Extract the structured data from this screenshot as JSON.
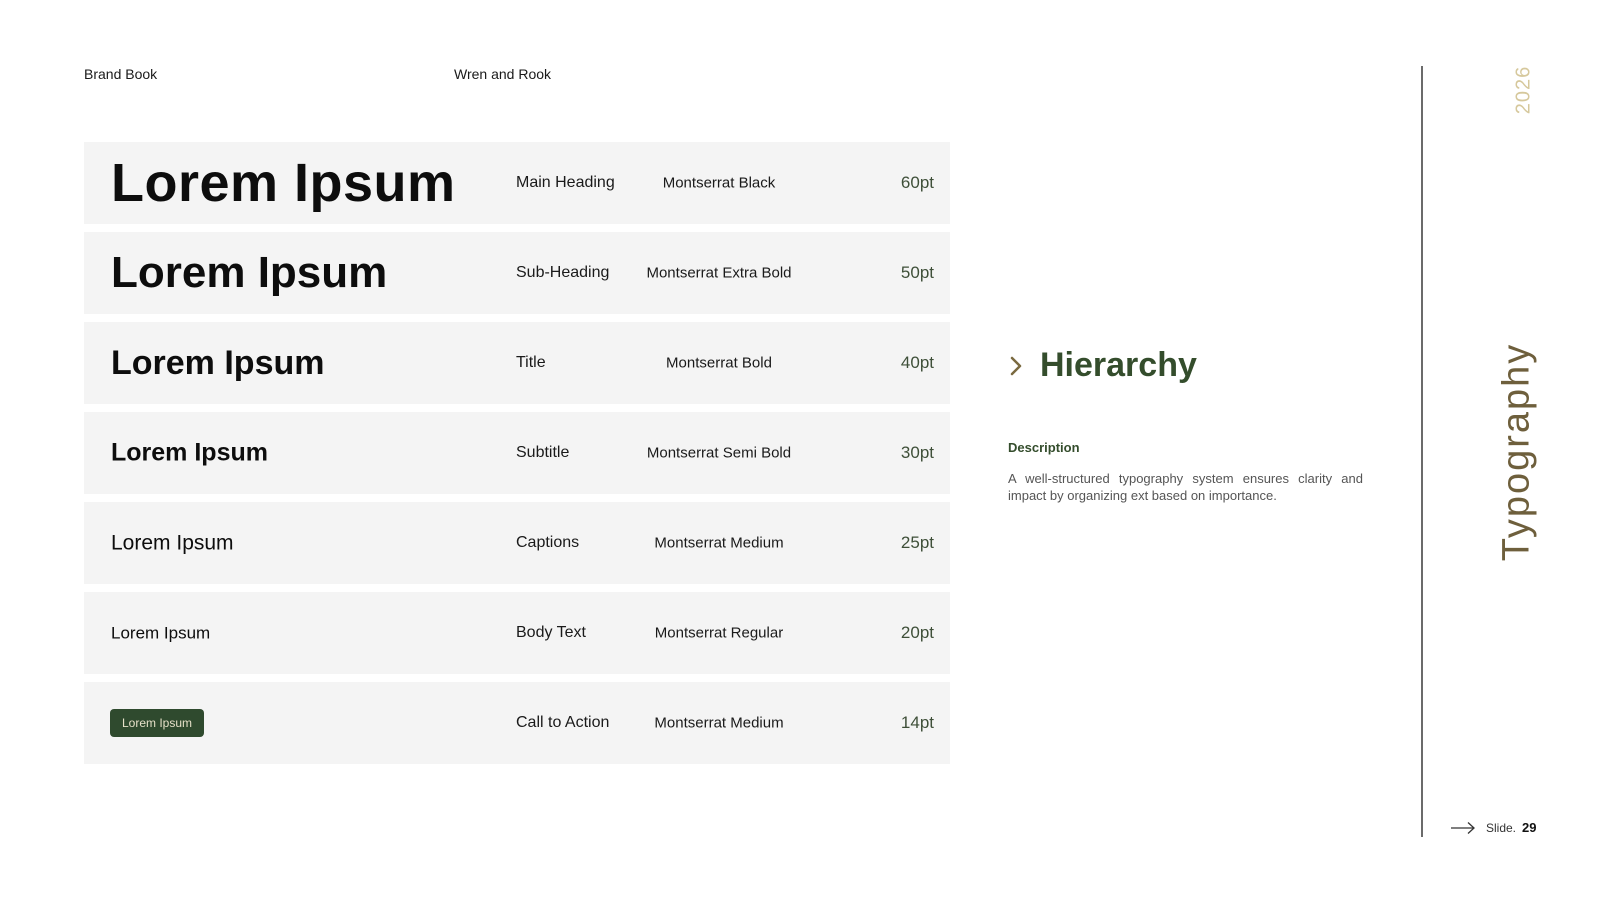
{
  "header": {
    "brand": "Brand Book",
    "company": "Wren and Rook"
  },
  "hierarchy_rows": [
    {
      "sample": "Lorem Ipsum",
      "role": "Main Heading",
      "font": "Montserrat Black",
      "size": "60pt"
    },
    {
      "sample": "Lorem Ipsum",
      "role": "Sub-Heading",
      "font": "Montserrat Extra Bold",
      "size": "50pt"
    },
    {
      "sample": "Lorem Ipsum",
      "role": "Title",
      "font": "Montserrat Bold",
      "size": "40pt"
    },
    {
      "sample": "Lorem Ipsum",
      "role": "Subtitle",
      "font": "Montserrat Semi Bold",
      "size": "30pt"
    },
    {
      "sample": "Lorem Ipsum",
      "role": "Captions",
      "font": "Montserrat Medium",
      "size": "25pt"
    },
    {
      "sample": "Lorem Ipsum",
      "role": "Body Text",
      "font": "Montserrat Regular",
      "size": "20pt"
    },
    {
      "sample": "Lorem Ipsum",
      "role": "Call to Action",
      "font": "Montserrat Medium",
      "size": "14pt"
    }
  ],
  "section": {
    "title": "Hierarchy",
    "description_label": "Description",
    "description": "A well-structured typography system ensures clarity and impact by organizing ext based on importance."
  },
  "sidebar": {
    "year": "2026",
    "vertical_title": "Typography"
  },
  "footer": {
    "slide_label": "Slide.",
    "slide_number": "29"
  },
  "colors": {
    "accent_green": "#344d2c",
    "cta_bg": "#2f4a2e",
    "gold": "#d6c89c",
    "row_bg": "#f4f4f4"
  },
  "icons": {
    "hierarchy": "chevron-right-icon",
    "footer": "arrow-right-icon"
  }
}
